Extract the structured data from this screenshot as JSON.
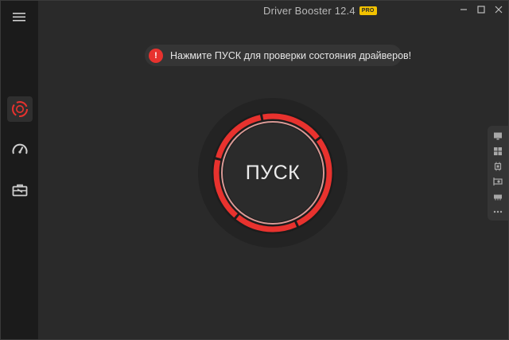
{
  "app": {
    "title": "Driver Booster 12.4",
    "badge": "PRO"
  },
  "sidebar": {
    "items": [
      {
        "name": "scan",
        "icon": "scan-target-icon",
        "active": true
      },
      {
        "name": "boost",
        "icon": "speedometer-icon",
        "active": false
      },
      {
        "name": "toolbox",
        "icon": "toolbox-icon",
        "active": false
      }
    ]
  },
  "notice": {
    "icon_text": "!",
    "text": "Нажмите ПУСК для проверки состояния драйверов!"
  },
  "scan": {
    "label": "ПУСК"
  },
  "right_panel": {
    "items": [
      {
        "icon": "monitor-icon"
      },
      {
        "icon": "windows-icon"
      },
      {
        "icon": "cpu-chip-icon"
      },
      {
        "icon": "graphics-card-icon"
      },
      {
        "icon": "memory-module-icon"
      },
      {
        "icon": "more-dots-icon"
      }
    ]
  },
  "colors": {
    "accent_red": "#e8322e",
    "background": "#2a2a2a",
    "sidebar": "#1b1b1b",
    "pro_badge": "#f2c200"
  }
}
